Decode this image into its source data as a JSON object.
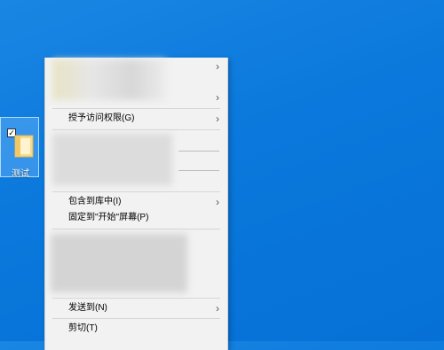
{
  "desktop": {
    "icon_label": "测试",
    "check_mark": "✓"
  },
  "menu": {
    "items": [
      {
        "label": "",
        "has_submenu": true
      },
      {
        "label": "",
        "has_submenu": true
      },
      {
        "label": "授予访问权限(G)",
        "has_submenu": true
      },
      {
        "label": "包含到库中(I)",
        "has_submenu": true
      },
      {
        "label": "固定到\"开始\"屏幕(P)",
        "has_submenu": false
      },
      {
        "label": "发送到(N)",
        "has_submenu": true
      },
      {
        "label": "剪切(T)",
        "has_submenu": false
      }
    ],
    "chevron": "›"
  },
  "colors": {
    "desktop": "#0a78dc",
    "menu_bg": "#f2f2f2",
    "annotation_arrow": "#e43a2c"
  }
}
